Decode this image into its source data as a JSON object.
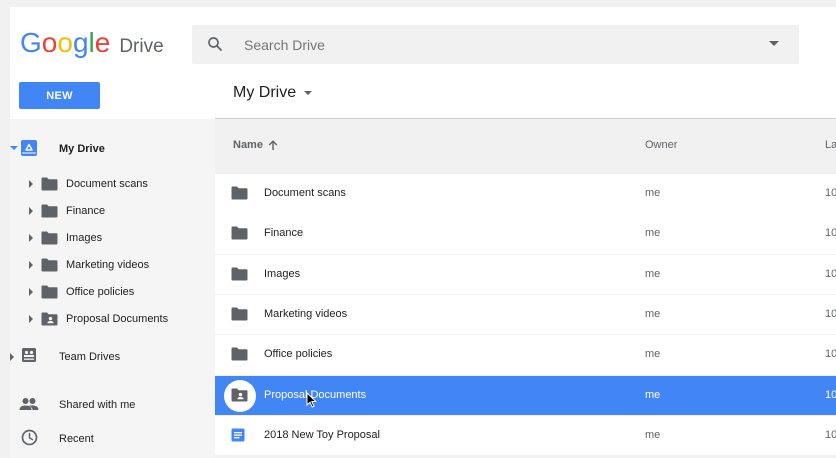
{
  "header": {
    "logo_word": "Google",
    "product": "Drive",
    "search_placeholder": "Search Drive"
  },
  "toolbar": {
    "new_label": "NEW",
    "location_title": "My Drive"
  },
  "sidebar": {
    "my_drive": "My Drive",
    "folders": [
      {
        "label": "Document scans",
        "icon": "folder-icon"
      },
      {
        "label": "Finance",
        "icon": "folder-icon"
      },
      {
        "label": "Images",
        "icon": "folder-icon"
      },
      {
        "label": "Marketing videos",
        "icon": "folder-icon"
      },
      {
        "label": "Office policies",
        "icon": "folder-icon"
      },
      {
        "label": "Proposal Documents",
        "icon": "shared-folder-icon"
      }
    ],
    "team_drives": "Team Drives",
    "shared_with_me": "Shared with me",
    "recent": "Recent"
  },
  "list": {
    "columns": {
      "name": "Name",
      "owner": "Owner",
      "last": "La"
    },
    "rows": [
      {
        "name": "Document scans",
        "owner": "me",
        "last": "10",
        "icon": "folder-icon",
        "selected": false
      },
      {
        "name": "Finance",
        "owner": "me",
        "last": "10",
        "icon": "folder-icon",
        "selected": false
      },
      {
        "name": "Images",
        "owner": "me",
        "last": "10",
        "icon": "folder-icon",
        "selected": false
      },
      {
        "name": "Marketing videos",
        "owner": "me",
        "last": "10",
        "icon": "folder-icon",
        "selected": false
      },
      {
        "name": "Office policies",
        "owner": "me",
        "last": "10",
        "icon": "folder-icon",
        "selected": false
      },
      {
        "name": "Proposal Documents",
        "owner": "me",
        "last": "10",
        "icon": "shared-folder-icon",
        "selected": true
      },
      {
        "name": "2018 New Toy Proposal",
        "owner": "me",
        "last": "10",
        "icon": "doc-icon",
        "selected": false
      }
    ]
  },
  "colors": {
    "accent": "#4285f4",
    "folder": "#5f6368",
    "logo": [
      "#4285f4",
      "#ea4335",
      "#fbbc05",
      "#4285f4",
      "#34a853",
      "#ea4335"
    ]
  }
}
